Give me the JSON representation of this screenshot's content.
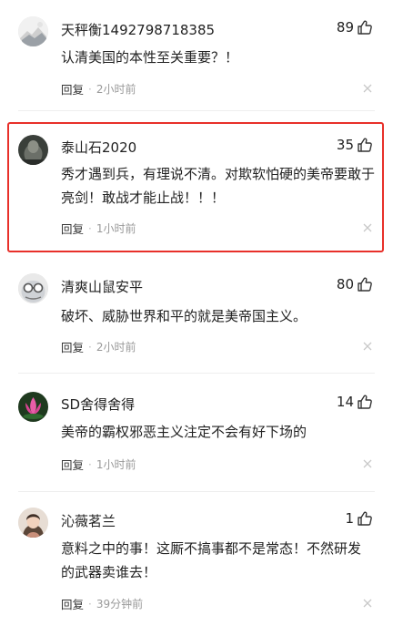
{
  "comments": [
    {
      "username": "天秤衡1492798718385",
      "likes": "89",
      "text": "认清美国的本性至关重要？！",
      "reply_label": "回复",
      "time": "2小时前",
      "avatar": "avatar-landscape"
    },
    {
      "username": "泰山石2020",
      "likes": "35",
      "text": "秀才遇到兵，有理说不清。对欺软怕硬的美帝要敢于亮剑！敢战才能止战！！！",
      "reply_label": "回复",
      "time": "1小时前",
      "avatar": "avatar-stone",
      "highlighted": true
    },
    {
      "username": "清爽山鼠安平",
      "likes": "80",
      "text": "破坏、威胁世界和平的就是美帝国主义。",
      "reply_label": "回复",
      "time": "2小时前",
      "avatar": "avatar-glasses"
    },
    {
      "username": "SD舍得舍得",
      "likes": "14",
      "text": "美帝的霸权邪恶主义注定不会有好下场的",
      "reply_label": "回复",
      "time": "1小时前",
      "avatar": "avatar-lotus"
    },
    {
      "username": "沁薇茗兰",
      "likes": "1",
      "text": "意料之中的事！这厮不搞事都不是常态！不然研发的武器卖谁去！",
      "reply_label": "回复",
      "time": "39分钟前",
      "avatar": "avatar-portrait"
    }
  ],
  "colors": {
    "highlight_border": "#e8302a",
    "meta_text": "#999999",
    "divider": "#eeeeee"
  },
  "icons": {
    "like": "thumbs-up-icon",
    "close": "close-icon"
  }
}
